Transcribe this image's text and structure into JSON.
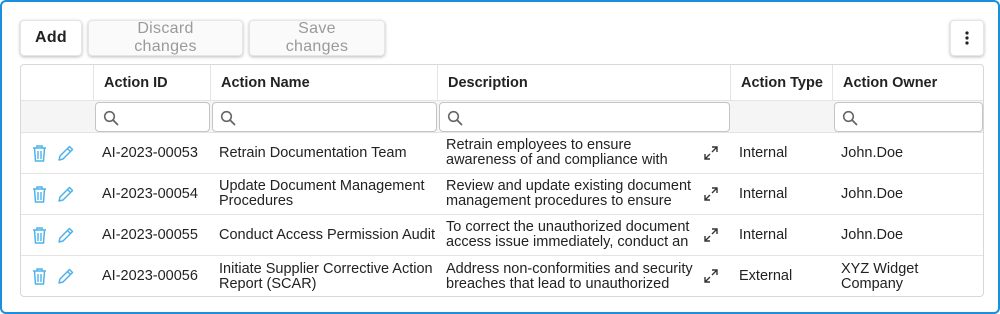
{
  "toolbar": {
    "add_label": "Add",
    "discard_label": "Discard changes",
    "save_label": "Save changes"
  },
  "columns": {
    "action_id": "Action ID",
    "action_name": "Action Name",
    "description": "Description",
    "action_type": "Action Type",
    "action_owner": "Action Owner"
  },
  "rows": [
    {
      "action_id": "AI-2023-00053",
      "action_name": "Retrain Documentation Team",
      "description": "Retrain employees to ensure awareness of and compliance with",
      "action_type": "Internal",
      "action_owner": "John.Doe"
    },
    {
      "action_id": "AI-2023-00054",
      "action_name": "Update Document Management Procedures",
      "description": "Review and update existing document management procedures to ensure",
      "action_type": "Internal",
      "action_owner": "John.Doe"
    },
    {
      "action_id": "AI-2023-00055",
      "action_name": "Conduct Access Permission Audit",
      "description": "To correct the unauthorized document access issue immediately, conduct an",
      "action_type": "Internal",
      "action_owner": "John.Doe"
    },
    {
      "action_id": "AI-2023-00056",
      "action_name": "Initiate Supplier Corrective Action Report (SCAR)",
      "description": "Address non-conformities and security breaches that lead to unauthorized",
      "action_type": "External",
      "action_owner": "XYZ Widget Company"
    }
  ],
  "icons": {
    "delete": "trash-icon",
    "edit": "pencil-icon",
    "expand": "expand-icon",
    "filter": "search-icon",
    "menu": "more-vertical-icon"
  },
  "colors": {
    "frame_border": "#1a8fdc",
    "action_icon": "#4db3e8"
  }
}
